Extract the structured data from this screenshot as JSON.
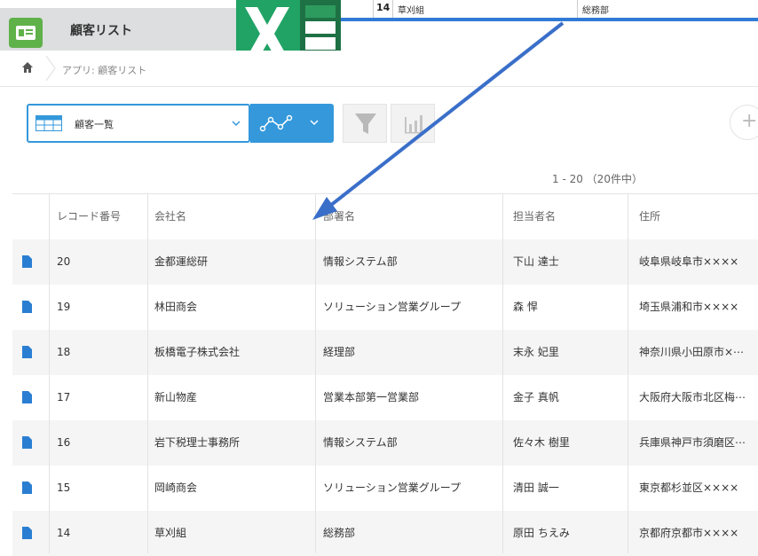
{
  "excel_strip": {
    "record": "14",
    "company": "草刈組",
    "department": "総務部"
  },
  "app": {
    "title": "顧客リスト"
  },
  "breadcrumb": {
    "text": "アプリ: 顧客リスト"
  },
  "toolbar": {
    "view_label": "顧客一覧"
  },
  "pager": {
    "text": "1 - 20 （20件中）"
  },
  "table": {
    "headers": [
      "レコード番号",
      "会社名",
      "部署名",
      "担当者名",
      "住所"
    ],
    "rows": [
      {
        "id": "20",
        "company": "金都運総研",
        "department": "情報システム部",
        "person": "下山 達士",
        "address": "岐阜県岐阜市××××"
      },
      {
        "id": "19",
        "company": "林田商会",
        "department": "ソリューション営業グループ",
        "person": "森 悍",
        "address": "埼玉県浦和市××××"
      },
      {
        "id": "18",
        "company": "板橋電子株式会社",
        "department": "経理部",
        "person": "末永 妃里",
        "address": "神奈川県小田原市×⋯"
      },
      {
        "id": "17",
        "company": "新山物産",
        "department": "営業本部第一営業部",
        "person": "金子 真帆",
        "address": "大阪府大阪市北区梅⋯"
      },
      {
        "id": "16",
        "company": "岩下税理士事務所",
        "department": "情報システム部",
        "person": "佐々木 樹里",
        "address": "兵庫県神戸市須磨区⋯"
      },
      {
        "id": "15",
        "company": "岡崎商会",
        "department": "ソリューション営業グループ",
        "person": "清田 誠一",
        "address": "東京都杉並区××××"
      },
      {
        "id": "14",
        "company": "草刈組",
        "department": "総務部",
        "person": "原田 ちえみ",
        "address": "京都府京都市××××"
      }
    ]
  },
  "colors": {
    "accent": "#3498db",
    "excel_green": "#1e7145",
    "app_green": "#5fb14a",
    "arrow": "#3a6fc9"
  }
}
